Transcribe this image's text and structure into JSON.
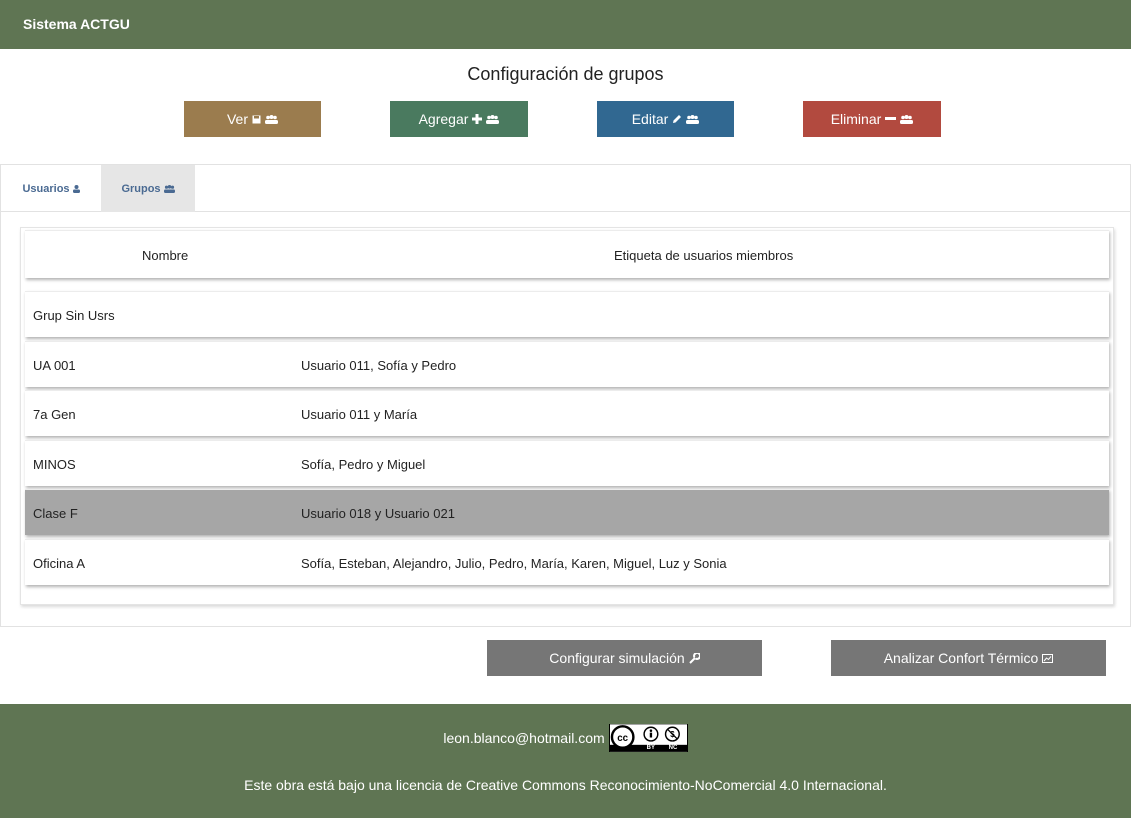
{
  "header": {
    "brand": "Sistema ACTGU"
  },
  "page": {
    "title": "Configuración de grupos"
  },
  "actions": [
    {
      "label": "Ver",
      "icon": "save-icon",
      "color": "#9b7c4e"
    },
    {
      "label": "Agregar",
      "icon": "plus-icon",
      "color": "#4a7a5f"
    },
    {
      "label": "Editar",
      "icon": "pencil-icon",
      "color": "#316891"
    },
    {
      "label": "Eliminar",
      "icon": "minus-icon",
      "color": "#b24a3f"
    }
  ],
  "tabs": [
    {
      "label": "Usuarios",
      "icon": "user-icon",
      "active": false
    },
    {
      "label": "Grupos",
      "icon": "users-icon",
      "active": true
    }
  ],
  "table": {
    "headers": {
      "name": "Nombre",
      "members": "Etiqueta de usuarios miembros"
    },
    "rows": [
      {
        "name": "Grup Sin Usrs",
        "members": "",
        "selected": false
      },
      {
        "name": "UA 001",
        "members": "Usuario 011, Sofía y Pedro",
        "selected": false
      },
      {
        "name": "7a Gen",
        "members": "Usuario 011 y María",
        "selected": false
      },
      {
        "name": "MINOS",
        "members": "Sofía, Pedro y Miguel",
        "selected": false
      },
      {
        "name": "Clase F",
        "members": "Usuario 018 y Usuario 021",
        "selected": true
      },
      {
        "name": "Oficina A",
        "members": "Sofía, Esteban, Alejandro, Julio, Pedro, María, Karen, Miguel, Luz y Sonia",
        "selected": false
      }
    ]
  },
  "bottom_actions": {
    "configure": {
      "label": "Configurar simulación",
      "icon": "wrench-icon"
    },
    "analyze": {
      "label": "Analizar Confort Térmico",
      "icon": "chart-icon"
    }
  },
  "footer": {
    "email": "leon.blanco@hotmail.com",
    "badge_by": "BY",
    "badge_nc": "NC",
    "license": "Este obra está bajo una licencia de Creative Commons Reconocimiento-NoComercial 4.0 Internacional."
  },
  "colors": {
    "header_bg": "#5f7553",
    "selected_row": "#a6a6a6",
    "secondary_btn": "#767676"
  }
}
